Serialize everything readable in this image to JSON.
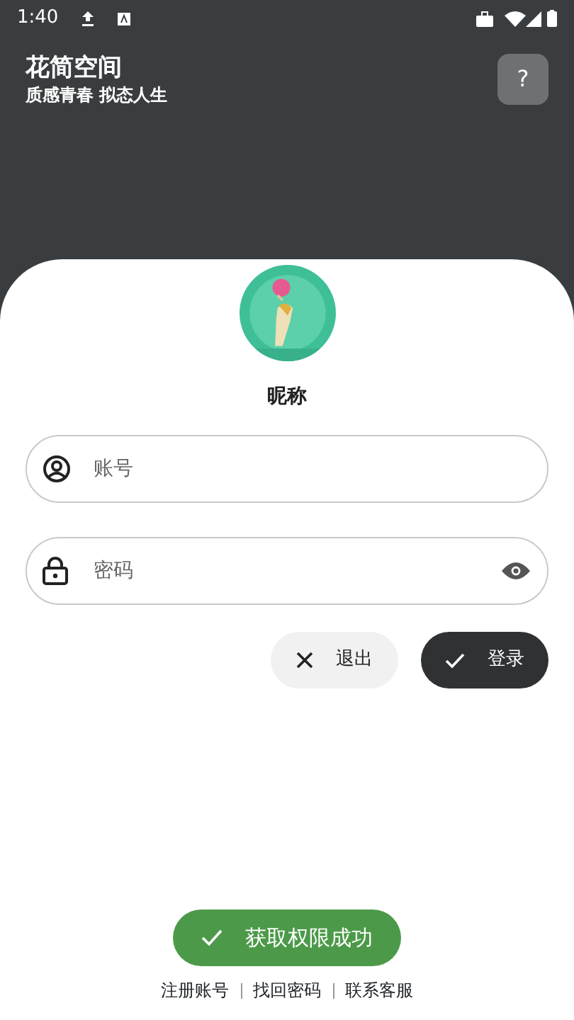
{
  "status_bar": {
    "time": "1:40"
  },
  "header": {
    "title": "花简空间",
    "subtitle": "质感青春 拟态人生",
    "help_button": "?"
  },
  "profile": {
    "nickname": "昵称"
  },
  "fields": [
    {
      "kind": "account",
      "placeholder": "账号"
    },
    {
      "kind": "password",
      "placeholder": "密码"
    }
  ],
  "buttons": [
    {
      "kind": "secondary",
      "label": "退出"
    },
    {
      "kind": "primary",
      "label": "登录"
    }
  ],
  "footer_links": [
    "注册账号",
    "找回密码",
    "联系客服"
  ],
  "toast": {
    "text": "获取权限成功"
  }
}
